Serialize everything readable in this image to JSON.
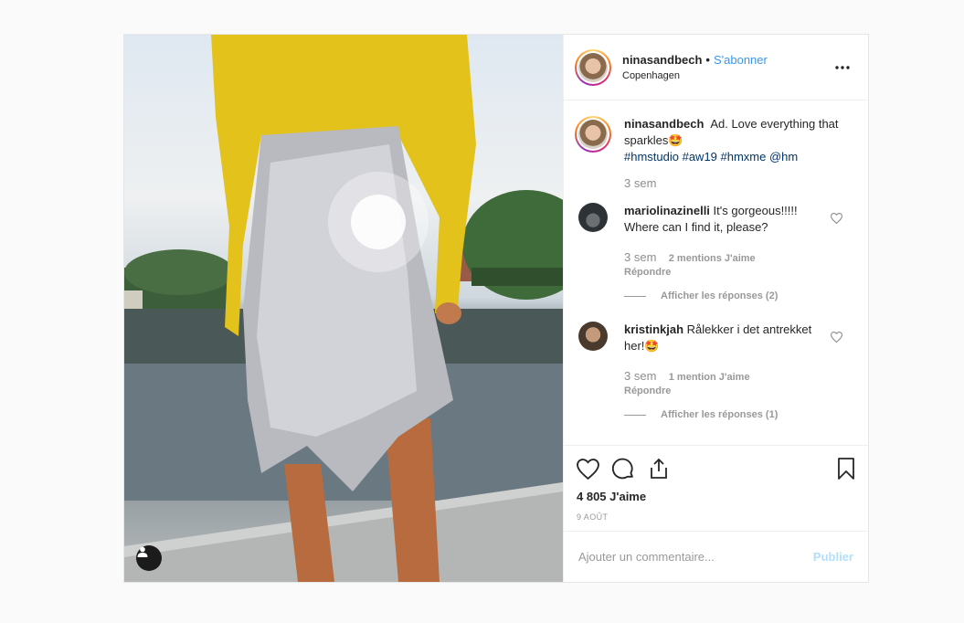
{
  "post": {
    "username": "ninasandbech",
    "follow_label": "S'abonner",
    "separator": "•",
    "location": "Copenhagen",
    "more_icon": "more-horizontal-icon",
    "caption": {
      "username": "ninasandbech",
      "text": "Ad. Love everything that sparkles",
      "emoji": "🤩",
      "hashtags": "#hmstudio #aw19 #hmxme @hm",
      "time": "3 sem"
    },
    "comments": [
      {
        "username": "mariolinazinelli",
        "text": "It's gorgeous!!!!! Where can I find it, please?",
        "time": "3 sem",
        "likes": "2 mentions J'aime",
        "reply_label": "Répondre",
        "view_replies": "Afficher les réponses (2)"
      },
      {
        "username": "kristinkjah",
        "text": "Rålekker i det antrekket her!",
        "emoji": "🤩",
        "time": "3 sem",
        "likes": "1 mention J'aime",
        "reply_label": "Répondre",
        "view_replies": "Afficher les réponses (1)"
      }
    ],
    "likes_count": "4 805 J'aime",
    "date": "9 AOÛT",
    "comment_placeholder": "Ajouter un commentaire...",
    "publish_label": "Publier"
  },
  "colors": {
    "link": "#3897f0",
    "hashtag": "#003569",
    "muted": "#999999",
    "publish_disabled": "#b2dffc"
  }
}
